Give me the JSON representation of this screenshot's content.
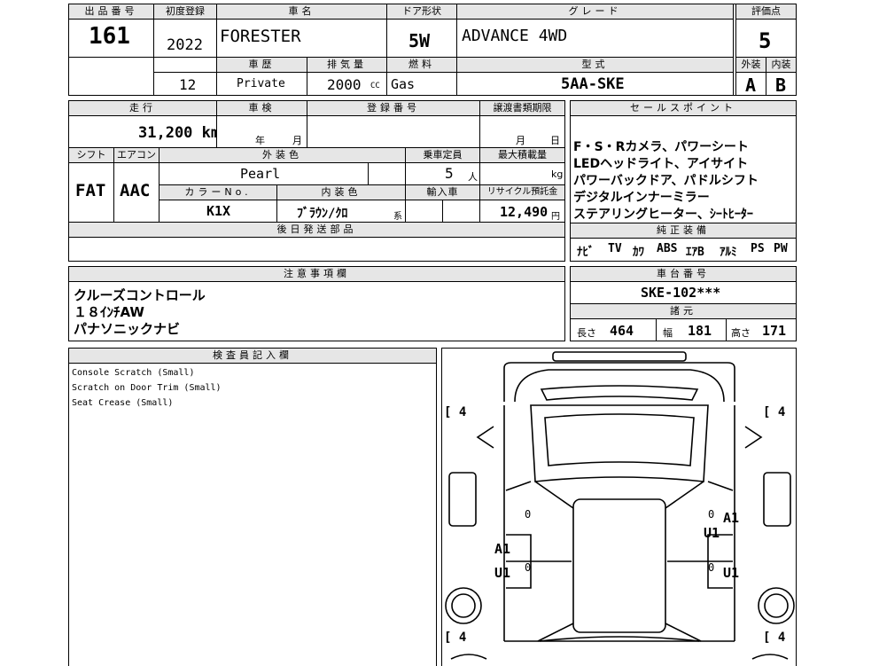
{
  "headers": {
    "lot_no": "出品番号",
    "first_reg": "初度登録",
    "car_name": "車名",
    "door_type": "ドア形状",
    "grade": "グレード",
    "score": "評価点",
    "history": "車歴",
    "displacement": "排気量",
    "fuel": "燃料",
    "model_code": "型式",
    "exterior": "外装",
    "interior": "内装",
    "mileage": "走行",
    "inspection": "車検",
    "reg_no": "登録番号",
    "transfer_deadline": "譲渡書類期限",
    "sales_points": "セールスポイント",
    "shift": "シフト",
    "aircon": "エアコン",
    "ext_color": "外装色",
    "capacity": "乗車定員",
    "max_load": "最大積載量",
    "color_no": "カラーNo.",
    "int_color": "内装色",
    "import": "輸入車",
    "recycle": "リサイクル預託金",
    "later_parts": "後日発送部品",
    "genuine_equipment": "純正装備",
    "notes": "注意事項欄",
    "chassis_no": "車台番号",
    "specs": "諸元",
    "inspector_notes": "検査員記入欄"
  },
  "lot_no": "161",
  "year": "2022",
  "car_name": "FORESTER",
  "door": "5W",
  "grade": "ADVANCE 4WD",
  "score": "5",
  "history_no": "12",
  "history": "Private",
  "displacement": "2000",
  "cc": "CC",
  "fuel": "Gas",
  "model_code": "5AA-SKE",
  "exterior_grade": "A",
  "interior_grade": "B",
  "mileage": "31,200 km",
  "year_unit": "年",
  "month_unit": "月",
  "day_unit": "日",
  "shift": "FAT",
  "aircon": "AAC",
  "ext_color": "Pearl",
  "capacity": "5",
  "capacity_unit": "人",
  "kg": "kg",
  "color_no": "K1X",
  "int_color": "ﾌﾞﾗｳﾝ/ｸﾛ",
  "int_color_suffix": "系",
  "recycle": "12,490",
  "yen": "円",
  "sales_points": [
    "F・S・Rカメラ、パワーシート",
    "LEDヘッドライト、アイサイト",
    "パワーバックドア、パドルシフト",
    "デジタルインナーミラー",
    "ステアリングヒーター、ｼｰﾄﾋｰﾀｰ"
  ],
  "equipment": [
    "ﾅﾋﾞ",
    "TV",
    "ｶﾜ",
    "ABS",
    "ｴｱB",
    "ｱﾙﾐ",
    "PS",
    "PW"
  ],
  "notes": [
    "クルーズコントロール",
    "１８ｲﾝﾁAW",
    "パナソニックナビ"
  ],
  "chassis_no": "SKE-102***",
  "specs": {
    "length_label": "長さ",
    "length": "464",
    "width_label": "幅",
    "width": "181",
    "height_label": "高さ",
    "height": "171"
  },
  "inspector_notes": [
    "Console Scratch (Small)",
    "Scratch on Door Trim (Small)",
    "Seat Crease (Small)"
  ],
  "diagram": {
    "tread_tl": "[ 4",
    "tread_tr": "[ 4",
    "tread_bl": "[ 4",
    "tread_br": "[ 4",
    "zero_l": "0",
    "zero_r": "0",
    "zero_bl": "0",
    "zero_br": "0",
    "mark_a1_r": "A1",
    "mark_u1_r": "U1",
    "mark_a1_l": "A1",
    "mark_u1_l": "U1",
    "mark_u1_br": "U1"
  }
}
